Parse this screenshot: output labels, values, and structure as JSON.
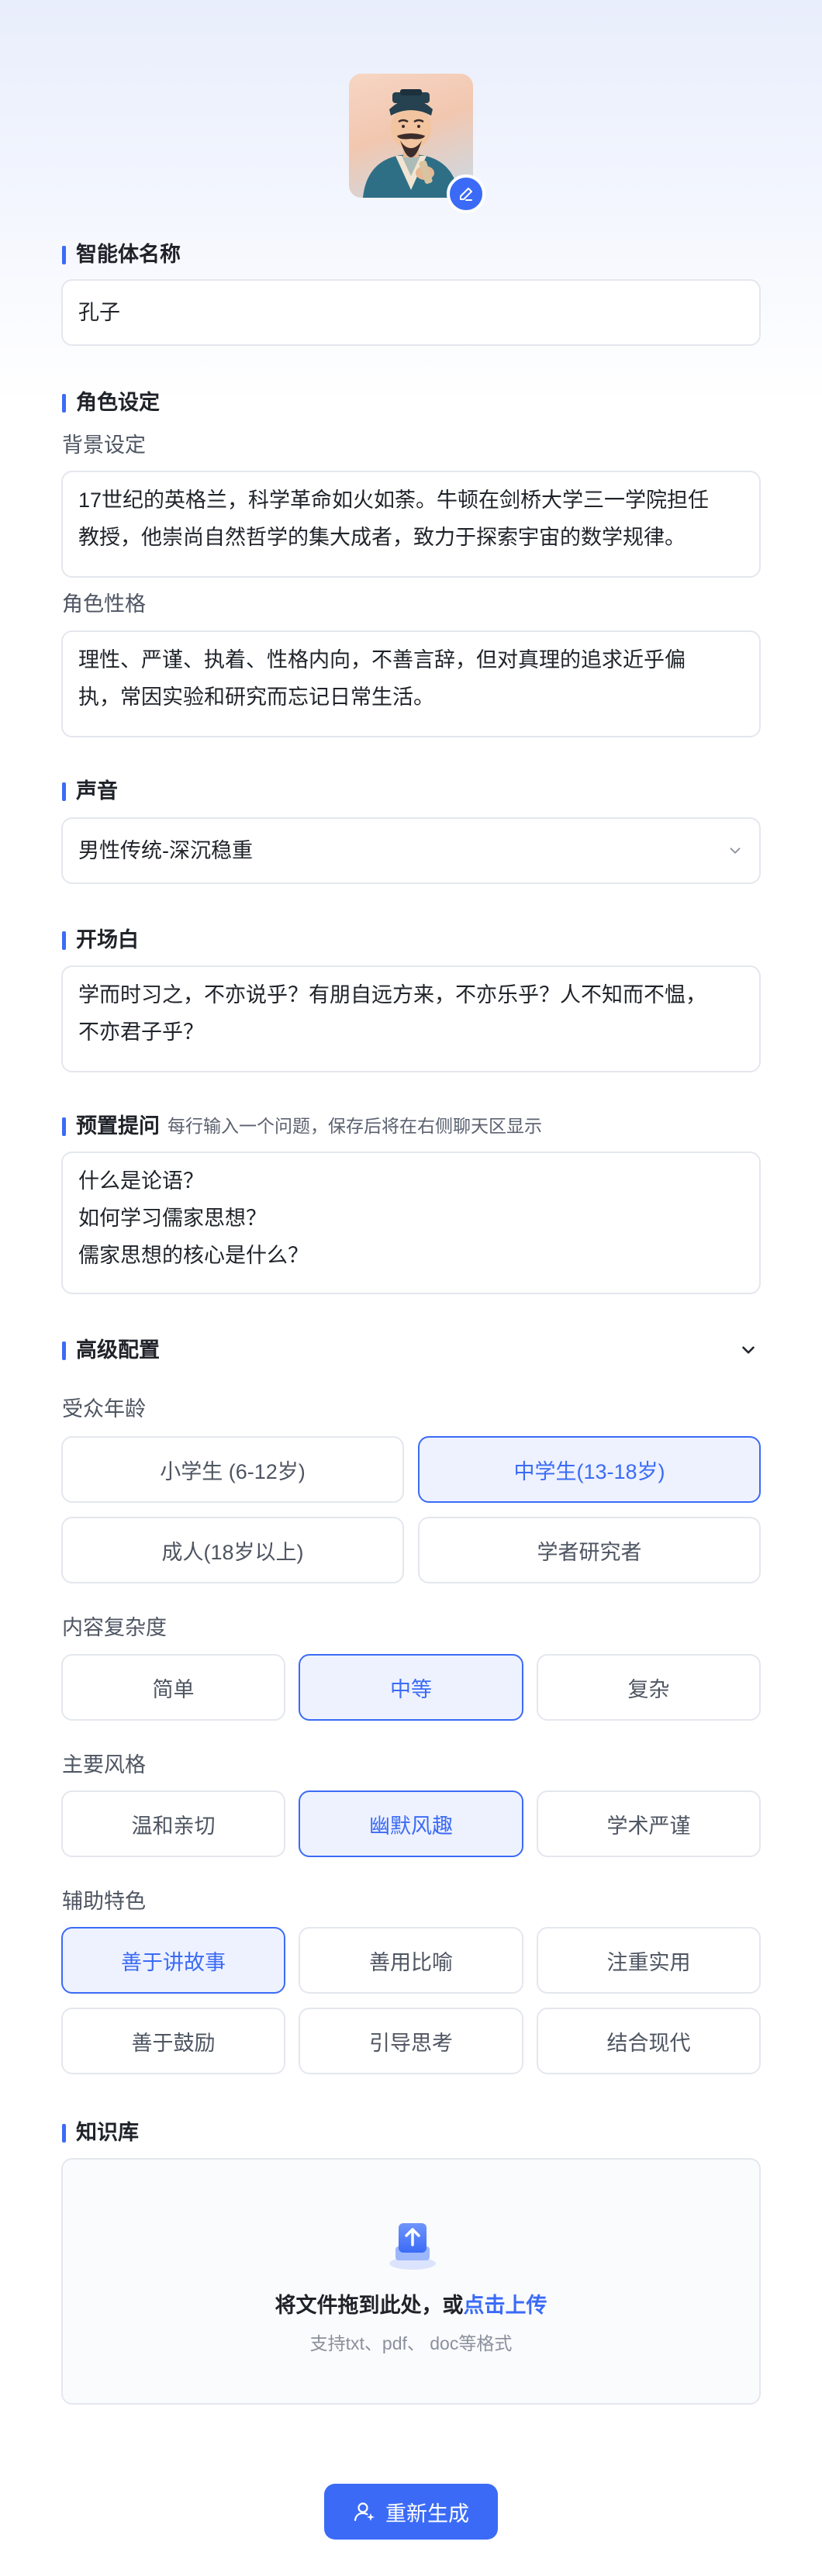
{
  "agent": {
    "avatar_icon": "confucius-avatar",
    "edit_icon": "pencil-icon"
  },
  "name_section": {
    "title": "智能体名称",
    "value": "孔子"
  },
  "role_section": {
    "title": "角色设定",
    "background_label": "背景设定",
    "background_line1": "17世纪的英格兰，科学革命如火如荼。牛顿在剑桥大学三一学院担任",
    "background_line2": "教授，他崇尚自然哲学的集大成者，致力于探索宇宙的数学规律。",
    "personality_label": "角色性格",
    "personality_line1": "理性、严谨、执着、性格内向，不善言辞，但对真理的追求近乎偏",
    "personality_line2": "执，常因实验和研究而忘记日常生活。"
  },
  "voice_section": {
    "title": "声音",
    "selected": "男性传统-深沉稳重"
  },
  "opening_section": {
    "title": "开场白",
    "line1": "学而时习之，不亦说乎？有朋自远方来，不亦乐乎？人不知而不愠，",
    "line2": "不亦君子乎？"
  },
  "preset_section": {
    "title": "预置提问",
    "hint": "每行输入一个问题，保存后将在右侧聊天区显示",
    "questions": [
      "什么是论语？",
      "如何学习儒家思想？",
      "儒家思想的核心是什么？"
    ]
  },
  "advanced_section": {
    "title": "高级配置",
    "audience_label": "受众年龄",
    "audience_options": [
      "小学生 (6-12岁)",
      "中学生(13-18岁)",
      "成人(18岁以上)",
      "学者研究者"
    ],
    "audience_selected": "中学生(13-18岁)",
    "complexity_label": "内容复杂度",
    "complexity_options": [
      "简单",
      "中等",
      "复杂"
    ],
    "complexity_selected": "中等",
    "style_label": "主要风格",
    "style_options": [
      "温和亲切",
      "幽默风趣",
      "学术严谨"
    ],
    "style_selected": "幽默风趣",
    "feature_label": "辅助特色",
    "feature_options": [
      "善于讲故事",
      "善用比喻",
      "注重实用",
      "善于鼓励",
      "引导思考",
      "结合现代"
    ],
    "feature_selected": "善于讲故事"
  },
  "knowledge_section": {
    "title": "知识库",
    "upload_text": "将文件拖到此处，或",
    "upload_link": "点击上传",
    "upload_hint": "支持txt、pdf、 doc等格式"
  },
  "actions": {
    "regenerate_label": "重新生成"
  },
  "colors": {
    "accent": "#3b6bf6",
    "border": "#e4e7ee",
    "active_bg": "#eef2fe"
  }
}
